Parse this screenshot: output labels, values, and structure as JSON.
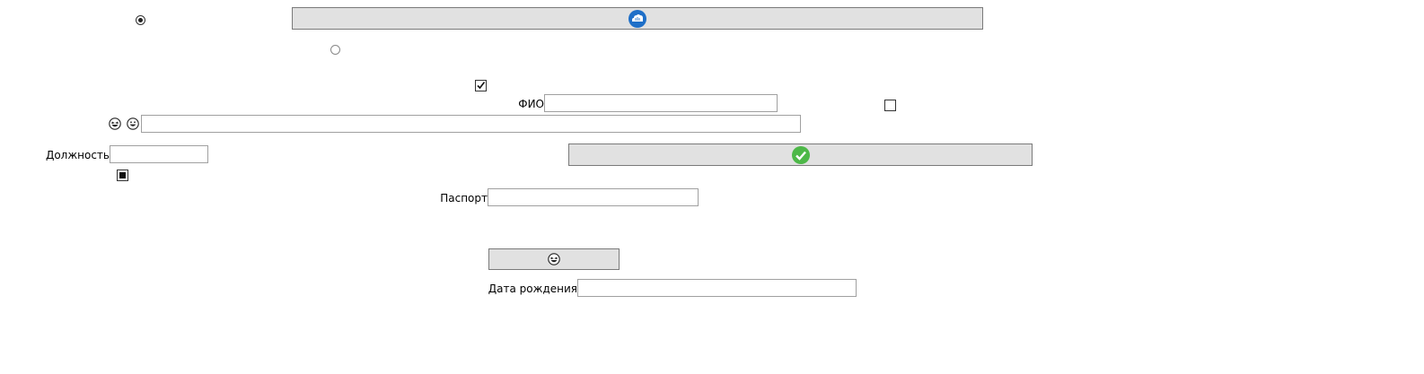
{
  "form": {
    "fio_label": "ФИО",
    "fio_value": "",
    "position_label": "Должность",
    "position_value": "",
    "passport_label": "Паспорт",
    "passport_value": "",
    "birthdate_label": "Дата рождения",
    "birthdate_value": "",
    "emoji_field_value": ""
  },
  "controls": {
    "radio_1_checked": true,
    "radio_2_checked": false,
    "checkbox_1_checked": true,
    "checkbox_2_checked": false,
    "checkbox_3_state": "indeterminate"
  },
  "icons": {
    "top_button_icon": "blue-cloud-icon",
    "middle_button_icon": "green-checkmark-icon",
    "bottom_button_icon": "laughing-face-icon",
    "emoji_label_icons": [
      "laughing-face-icon",
      "grinning-face-icon"
    ]
  },
  "colors": {
    "button_background": "#e1e1e1",
    "button_border": "#7a7a7a",
    "textbox_border": "#a0a0a0",
    "cloud_blue": "#1e6fc8",
    "check_green": "#4db848"
  }
}
